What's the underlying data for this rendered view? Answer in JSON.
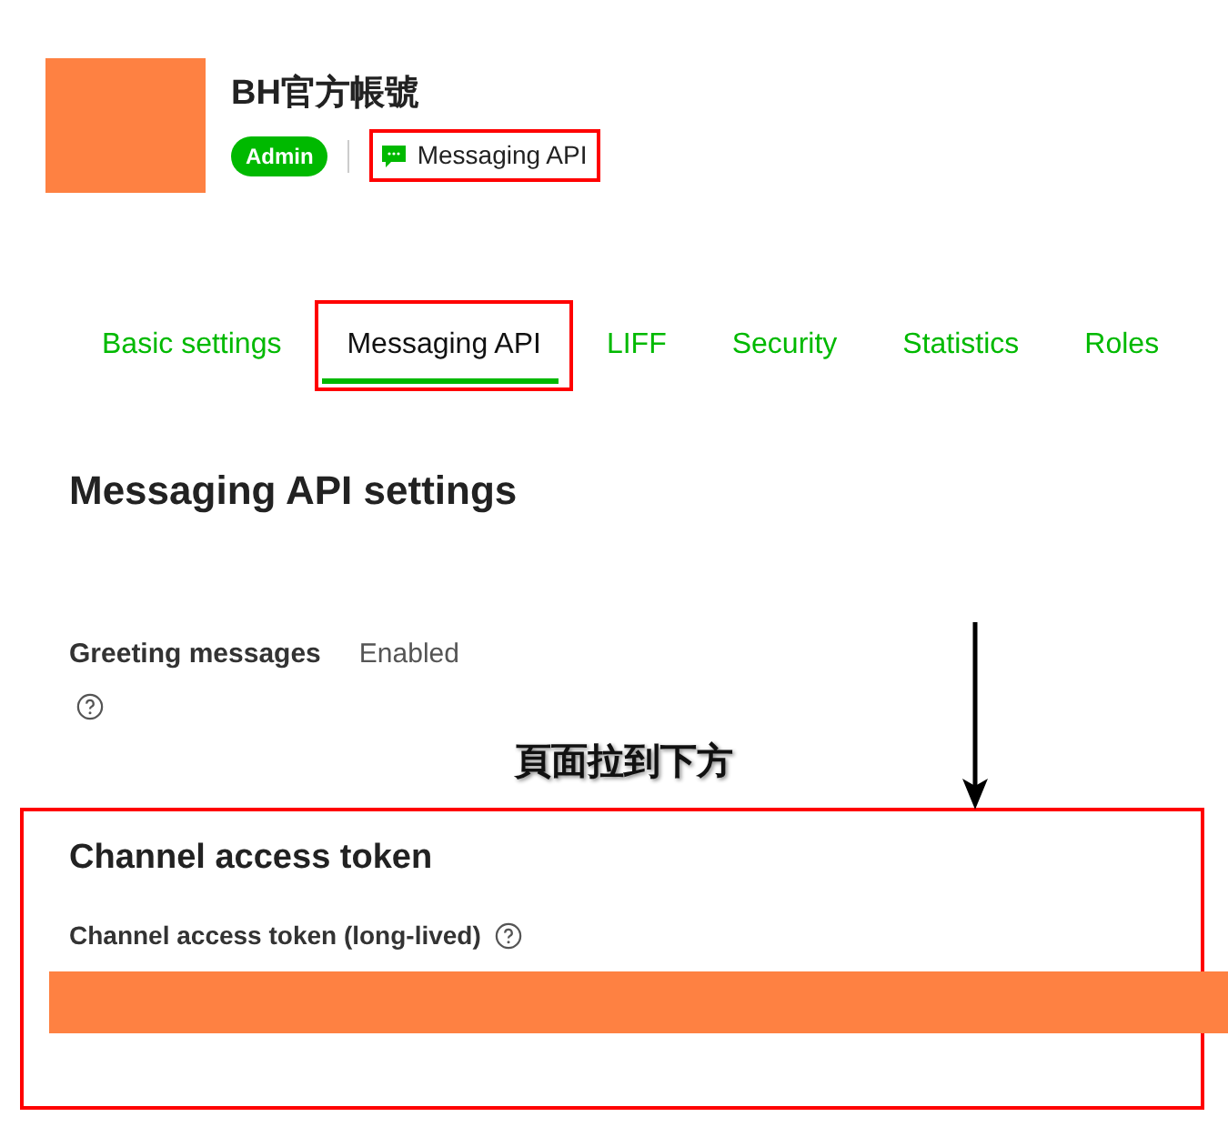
{
  "account": {
    "name": "BH官方帳號",
    "role_badge": "Admin",
    "channel_type": "Messaging API",
    "channel_type_highlighted": true
  },
  "tabs": [
    {
      "label": "Basic settings",
      "selected": false,
      "highlighted": false
    },
    {
      "label": "Messaging API",
      "selected": true,
      "highlighted": true
    },
    {
      "label": "LIFF",
      "selected": false,
      "highlighted": false
    },
    {
      "label": "Security",
      "selected": false,
      "highlighted": false
    },
    {
      "label": "Statistics",
      "selected": false,
      "highlighted": false
    },
    {
      "label": "Roles",
      "selected": false,
      "highlighted": false
    }
  ],
  "page_title": "Messaging API settings",
  "settings": [
    {
      "label": "Greeting messages",
      "value": "Enabled"
    }
  ],
  "annotation": {
    "caption": "頁面拉到下方"
  },
  "token_section": {
    "title": "Channel access token",
    "field_label": "Channel access token (long-lived)",
    "highlighted": true
  }
}
